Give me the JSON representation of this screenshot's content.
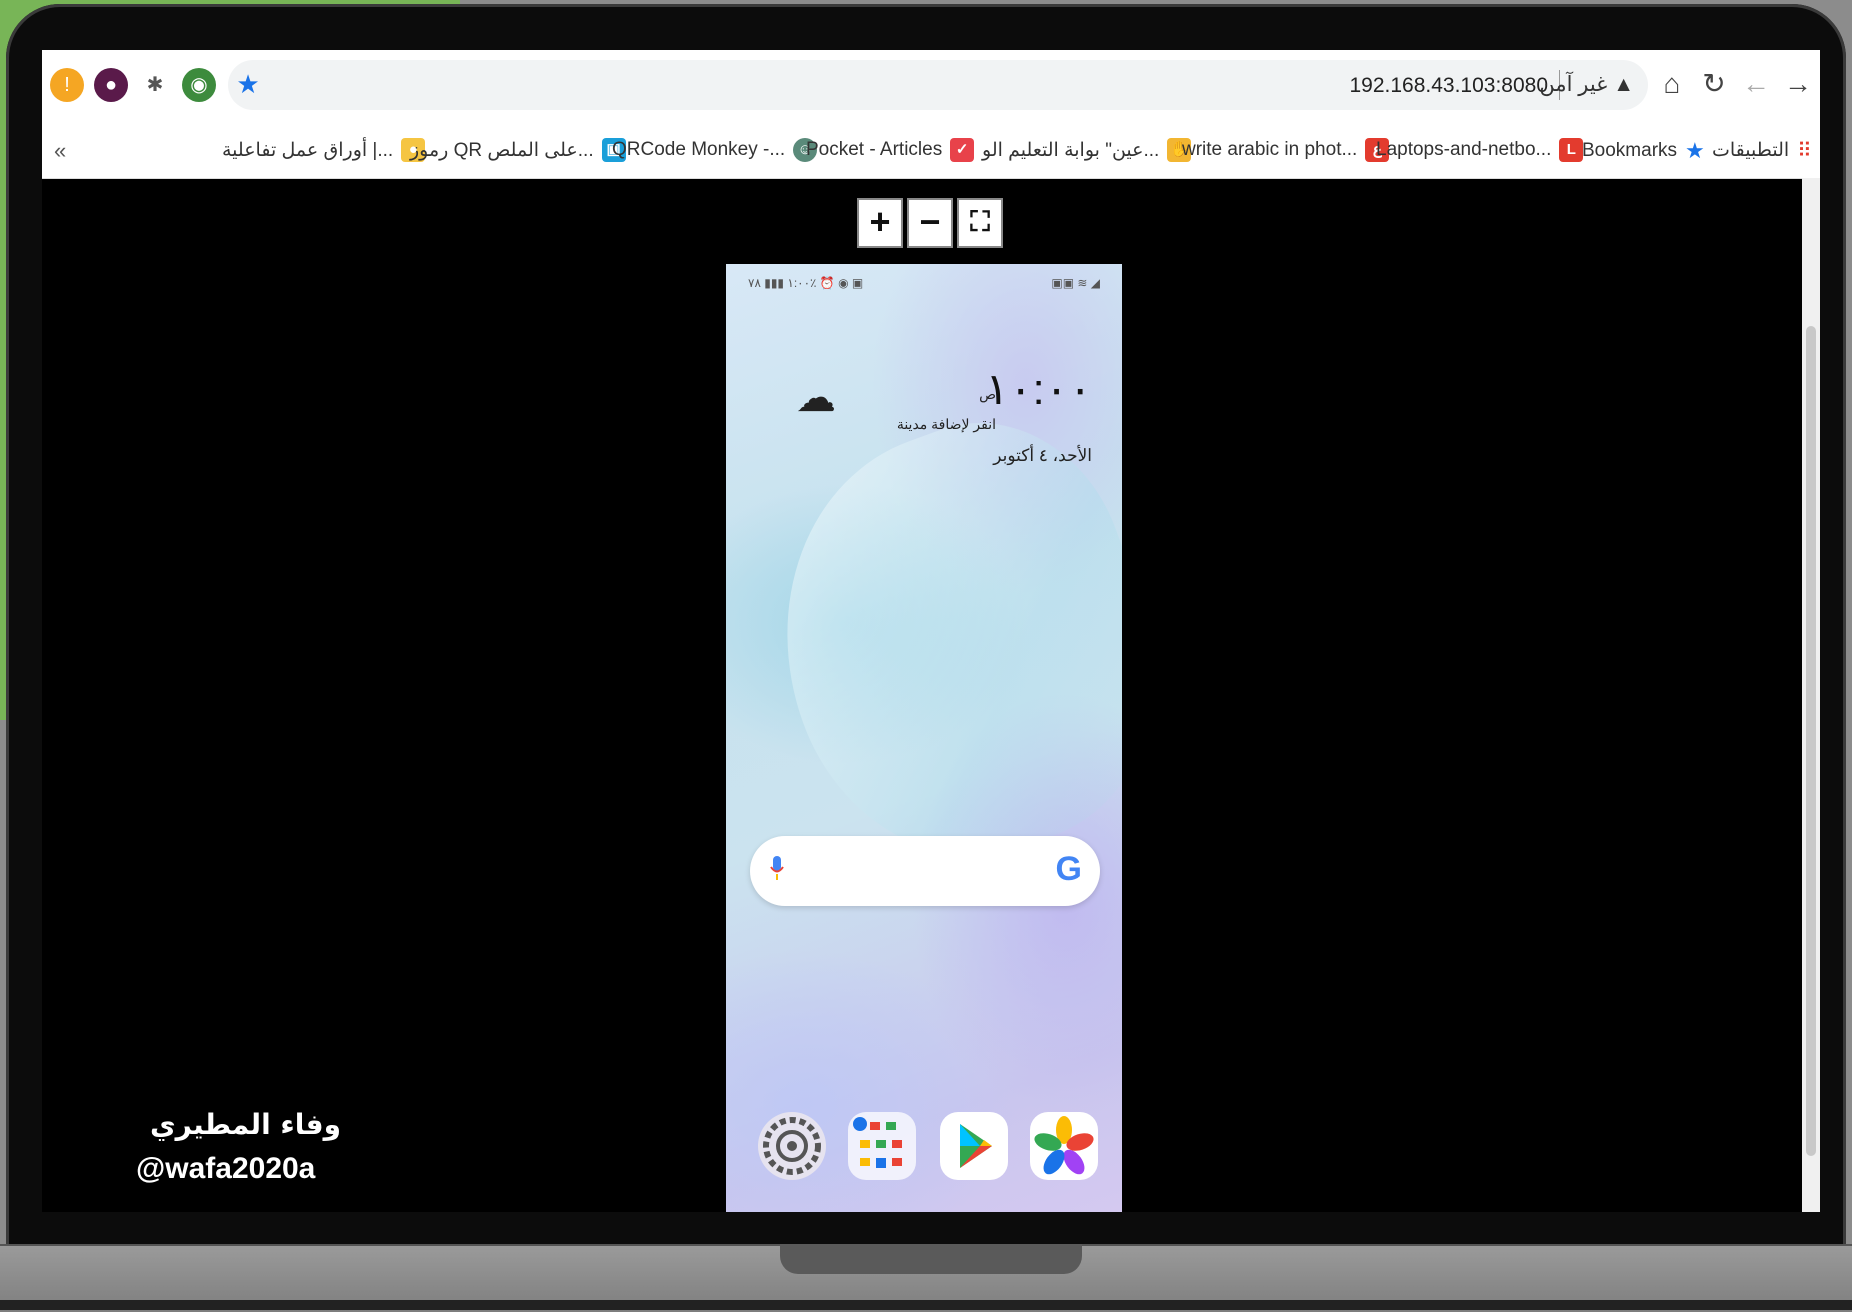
{
  "browser": {
    "url": "192.168.43.103:8080",
    "security_label": "غير آمن",
    "bookmarks": [
      {
        "label": "التطبيقات",
        "icon": "apps-grid-icon"
      },
      {
        "label": "Bookmarks",
        "icon": "star-icon"
      },
      {
        "label": "Laptops-and-netbo...",
        "icon": "L-icon"
      },
      {
        "label": "write arabic in phot...",
        "icon": "arabic-e-icon"
      },
      {
        "label": "عين\" بوابة التعليم الو...",
        "icon": "hand-icon"
      },
      {
        "label": "Pocket - Articles",
        "icon": "pocket-icon"
      },
      {
        "label": "QRCode Monkey -...",
        "icon": "monkey-icon"
      },
      {
        "label": "رموز QR على الملص...",
        "icon": "qr-icon"
      },
      {
        "label": "أوراق عمل تفاعلية |...",
        "icon": "bulb-icon"
      }
    ],
    "overflow": "«"
  },
  "zoom_controls": {
    "plus": "+",
    "minus": "−",
    "fit": "⛶"
  },
  "phone": {
    "status_left": "١:٠٠ ▮▮▮ ٧٨٪ ⏰ ◉ ▣",
    "status_right": "▣▣ ≋ ◢",
    "clock": "١٠:٠٠",
    "ampm": "ص",
    "add_city": "انقر لإضافة مدينة",
    "date": "الأحد، ٤ أكتوبر",
    "search_logo": "G"
  },
  "watermark": {
    "name": "وفاء المطيري",
    "handle": "@wafa2020a"
  }
}
